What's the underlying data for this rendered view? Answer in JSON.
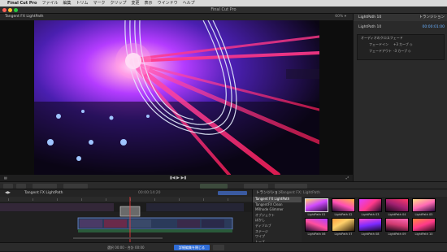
{
  "menubar": {
    "apple": "",
    "app": "Final Cut Pro",
    "items": [
      "ファイル",
      "編集",
      "トリム",
      "マーク",
      "クリップ",
      "変更",
      "表示",
      "ウインドウ",
      "ヘルプ"
    ]
  },
  "window": {
    "title": "Final Cut Pro"
  },
  "viewer": {
    "clip_title": "Tangent FX LightPath",
    "zoom": "60% ▾",
    "play_icon": "play-icon",
    "transport": "▮◀  ▶  ▶▮"
  },
  "inspector": {
    "header": "LightPath 10",
    "tab": "トランジション",
    "clip": "LightPath 10",
    "duration": "00:00:01:00",
    "section": "オーディオのクロスフェード",
    "rows": [
      {
        "label": "フェードイン",
        "value": "+3 カーブ ◇"
      },
      {
        "label": "フェードアウト",
        "value": "-3 カーブ ◇"
      }
    ]
  },
  "timeline": {
    "project": "Tangent FX LightPath",
    "timecode": "00:00:14:20"
  },
  "browser": {
    "title": "トランジション",
    "filter": "Tangent FX: LightPath",
    "categories": [
      "Tangent FX LightPath",
      "TangentFX Clean",
      "MRhode Glimmer",
      "オブジェクト",
      "ぼかし",
      "ディゾルブ",
      "ステージ",
      "ワイプ",
      "ムーブ"
    ],
    "thumbs": [
      "LightPath 01",
      "LightPath 02",
      "LightPath 03",
      "LightPath 04",
      "LightPath 05",
      "LightPath 06",
      "LightPath 07",
      "LightPath 08",
      "LightPath 09",
      "LightPath 10"
    ]
  },
  "status": {
    "left": "選択 00:00 - 合計 00:00",
    "button": "詳細編集を閉じる"
  },
  "colors": {
    "accent": "#2f6cd6",
    "close": "#ff5f57",
    "minimize": "#febc2e",
    "zoom": "#28c840",
    "clip": "#2b3a5a"
  }
}
